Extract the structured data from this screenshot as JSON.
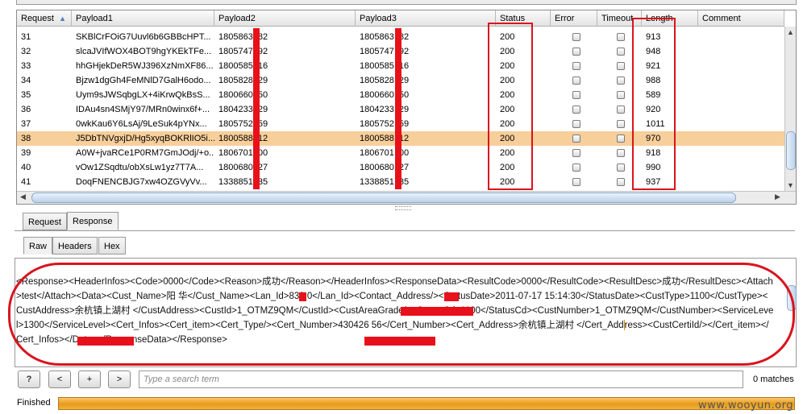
{
  "table": {
    "columns": [
      {
        "key": "request",
        "label": "Request",
        "sort_icon": "sort-ascending-icon"
      },
      {
        "key": "payload1",
        "label": "Payload1"
      },
      {
        "key": "payload2",
        "label": "Payload2"
      },
      {
        "key": "payload3",
        "label": "Payload3"
      },
      {
        "key": "status",
        "label": "Status"
      },
      {
        "key": "error",
        "label": "Error"
      },
      {
        "key": "timeout",
        "label": "Timeout"
      },
      {
        "key": "length",
        "label": "Length"
      },
      {
        "key": "comment",
        "label": "Comment"
      }
    ],
    "selected_request": "38",
    "rows": [
      {
        "request": "31",
        "payload1": "SKBlCrFOiG7Uuvl6b6GBBcHPT...",
        "payload2": "1805863  82",
        "payload3": "1805863  82",
        "status": "200",
        "length": "913"
      },
      {
        "request": "32",
        "payload1": "slcaJVIfWOX4BOT9hgYKEkTFe...",
        "payload2": "1805747  92",
        "payload3": "1805747  92",
        "status": "200",
        "length": "948"
      },
      {
        "request": "33",
        "payload1": "hhGHjekDeR5WJ396XzNmXF86...",
        "payload2": "1800585  16",
        "payload3": "1800585  16",
        "status": "200",
        "length": "921"
      },
      {
        "request": "34",
        "payload1": "Bjzw1dgGh4FeMNlD7GalH6odo...",
        "payload2": "1805828  29",
        "payload3": "1805828  29",
        "status": "200",
        "length": "988"
      },
      {
        "request": "35",
        "payload1": "Uym9sJWSqbgLX+4iKrwQkBsS...",
        "payload2": "1800660  50",
        "payload3": "1800660  50",
        "status": "200",
        "length": "589"
      },
      {
        "request": "36",
        "payload1": "IDAu4sn4SMjY97/MRn0winx6f+...",
        "payload2": "1804233  29",
        "payload3": "1804233  29",
        "status": "200",
        "length": "920"
      },
      {
        "request": "37",
        "payload1": "0wkKau6Y6LsAj/9LeSuk4pYNx...",
        "payload2": "1805752  59",
        "payload3": "1805752  59",
        "status": "200",
        "length": "1011"
      },
      {
        "request": "38",
        "payload1": "J5DbTNVgxjD/Hg5xyqBOKRlIO5i...",
        "payload2": "1800588  12",
        "payload3": "1800588  12",
        "status": "200",
        "length": "970"
      },
      {
        "request": "39",
        "payload1": "A0W+jvaRCe1P0RM7GmJOdj/+o...",
        "payload2": "1806701  00",
        "payload3": "1806701  00",
        "status": "200",
        "length": "918"
      },
      {
        "request": "40",
        "payload1": "vOw1ZSqdtu/obXsLw1yz7T7A...",
        "payload2": "1800680  27",
        "payload3": "1800680  27",
        "status": "200",
        "length": "990"
      },
      {
        "request": "41",
        "payload1": "DoqFNENCBJG7xw4OZGVyVv...",
        "payload2": "1338851  35",
        "payload3": "1338851  35",
        "status": "200",
        "length": "937"
      }
    ]
  },
  "message_tabs": {
    "request": "Request",
    "response": "Response",
    "active": "Response"
  },
  "view_tabs": {
    "raw": "Raw",
    "headers": "Headers",
    "hex": "Hex",
    "active": "Raw"
  },
  "response": {
    "text_before_cursor": "<Response><HeaderInfos><Code>0000</Code><Reason>成功</Reason></HeaderInfos><ResponseData><ResultCode>0000</ResultCode><ResultDesc>成功</ResultDesc><Attach>test</Attach><Data><Cust_Name>阳  华</Cust_Name><Lan_Id>833    0</Lan_Id><Contact_Address/><StatusDate>2011-07-17 15:14:30</StatusDate><CustType>1100</CustType><CustAddress>余杭镇上湖村                </CustAddress><CustId>1_OTMZ9QM</CustId><CustAreaGrade/><StatusCd>1100</StatusCd><CustNumber>1_OTMZ9QM</CustNumber><ServiceLevel>1300</ServiceLevel><Cert_Infos><Cert_item><Cert_Type/><Cert_Number>430426             56</Cert_Number><Cert_Address>余杭镇上湖村                </Cert_Add",
    "text_after_cursor": "ress><CustCertiId/></Cert_item></Cert_Infos></Data></ResponseData></Response>"
  },
  "search": {
    "help_label": "?",
    "prev_label": "<",
    "add_label": "+",
    "next_label": ">",
    "placeholder": "Type a search term",
    "matches": "0 matches"
  },
  "status": {
    "label": "Finished",
    "progress_percent": 100
  },
  "watermark": "www.wooyun.org",
  "colors": {
    "selected_row": "#f7cf9b",
    "annotation_red": "#d9141e",
    "progress": "#e89c18"
  }
}
